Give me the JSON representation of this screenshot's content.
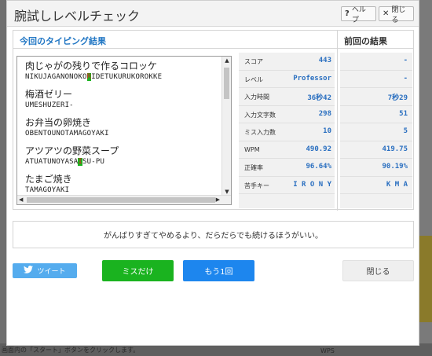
{
  "modal": {
    "title": "腕試しレベルチェック",
    "help_label": "ヘルプ",
    "close_x_label": "閉じる"
  },
  "results": {
    "current_header": "今回のタイピング結果",
    "previous_header": "前回の結果",
    "words": [
      {
        "jp": "肉じゃがの残りで作るコロッケ",
        "ro_before": "NIKUJAGANONOKO",
        "ro_miss": "R",
        "ro_after": "IDETUKURUKOROKKE"
      },
      {
        "jp": "梅酒ゼリー",
        "ro_before": "UMESHUZERI-",
        "ro_miss": "",
        "ro_after": ""
      },
      {
        "jp": "お弁当の卵焼き",
        "ro_before": "OBENTOUNOTAMAGOYAKI",
        "ro_miss": "",
        "ro_after": ""
      },
      {
        "jp": "アツアツの野菜スープ",
        "ro_before": "ATUATUNOYASA",
        "ro_miss": "I",
        "ro_after": "SU-PU"
      },
      {
        "jp": "たまご焼き",
        "ro_before": "TAMAGOYAKI",
        "ro_miss": "",
        "ro_after": ""
      }
    ],
    "stats": [
      {
        "label": "スコア",
        "value": "443",
        "prev": "-"
      },
      {
        "label": "レベル",
        "value": "Professor",
        "prev": "-"
      },
      {
        "label": "入力時間",
        "value": "36秒42",
        "prev": "7秒29"
      },
      {
        "label": "入力文字数",
        "value": "298",
        "prev": "51"
      },
      {
        "label": "ミス入力数",
        "value": "10",
        "prev": "5"
      },
      {
        "label": "WPM",
        "value": "490.92",
        "prev": "419.75"
      },
      {
        "label": "正確率",
        "value": "96.64%",
        "prev": "90.19%"
      },
      {
        "label": "苦手キー",
        "value": "I R O N Y",
        "prev": "K M A"
      }
    ]
  },
  "comment": "がんばりすぎてやめるより、だらだらでも続けるほうがいい。",
  "buttons": {
    "tweet": "ツイート",
    "miss_only": "ミスだけ",
    "retry": "もう1回",
    "close": "閉じる"
  },
  "background": {
    "bottom_text": "画面内の「スタート」ボタンをクリックします。",
    "bottom_radio": "WPS"
  },
  "colors": {
    "accent_blue": "#2277c4",
    "tweet": "#55acee",
    "miss_only": "#1ab31f",
    "retry": "#1d86ee"
  }
}
